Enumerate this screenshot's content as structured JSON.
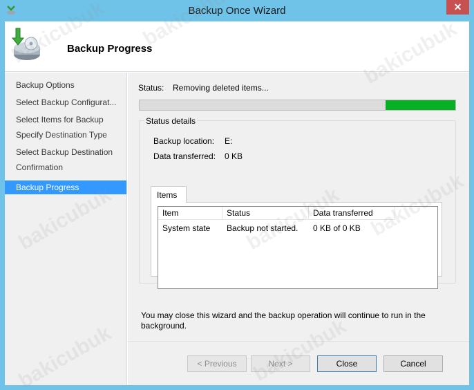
{
  "window": {
    "title": "Backup Once Wizard",
    "close_glyph": "✕"
  },
  "header": {
    "title": "Backup Progress",
    "icon": "backup-disk-icon"
  },
  "nav": {
    "items": [
      {
        "label": "Backup Options"
      },
      {
        "label": "Select Backup Configurat..."
      },
      {
        "label": "Select Items for Backup"
      },
      {
        "label": "Specify Destination Type"
      },
      {
        "label": "Select Backup Destination"
      },
      {
        "label": "Confirmation"
      },
      {
        "label": "Backup Progress",
        "active": true
      }
    ]
  },
  "status": {
    "label": "Status:",
    "value": "Removing deleted items...",
    "progress": 0.22,
    "progress_color": "#06b025"
  },
  "details": {
    "title": "Status details",
    "backup_location_label": "Backup location:",
    "backup_location_value": "E:",
    "data_transferred_label": "Data transferred:",
    "data_transferred_value": "0 KB"
  },
  "items_tab": {
    "label": "Items",
    "columns": [
      "Item",
      "Status",
      "Data transferred"
    ],
    "rows": [
      [
        "System state",
        "Backup not started.",
        "0 KB of 0 KB"
      ]
    ]
  },
  "note": "You may close this wizard and the backup operation will continue to run in the background.",
  "buttons": {
    "previous": "< Previous",
    "next": "Next >",
    "close": "Close",
    "cancel": "Cancel"
  },
  "watermark": "bakicubuk",
  "colors": {
    "titlebar": "#6fc3e8",
    "selection": "#3399ff",
    "close_button": "#c75050"
  }
}
